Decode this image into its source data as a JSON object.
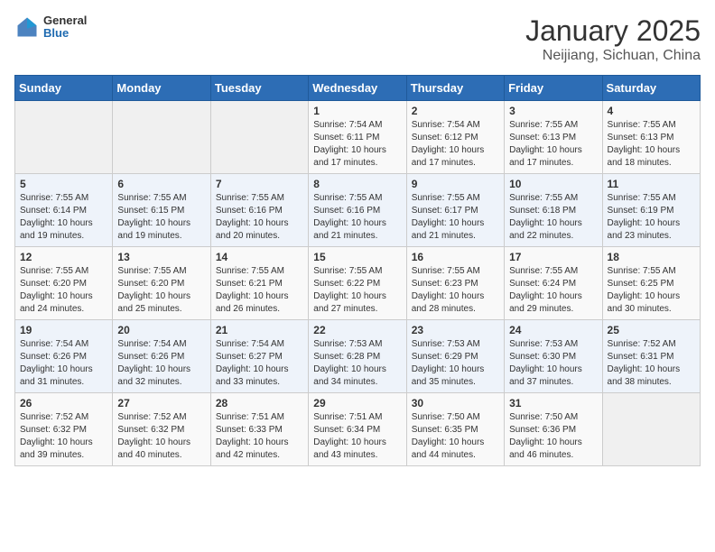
{
  "header": {
    "logo_general": "General",
    "logo_blue": "Blue",
    "title": "January 2025",
    "subtitle": "Neijiang, Sichuan, China"
  },
  "weekdays": [
    "Sunday",
    "Monday",
    "Tuesday",
    "Wednesday",
    "Thursday",
    "Friday",
    "Saturday"
  ],
  "weeks": [
    [
      {
        "day": "",
        "info": ""
      },
      {
        "day": "",
        "info": ""
      },
      {
        "day": "",
        "info": ""
      },
      {
        "day": "1",
        "info": "Sunrise: 7:54 AM\nSunset: 6:11 PM\nDaylight: 10 hours\nand 17 minutes."
      },
      {
        "day": "2",
        "info": "Sunrise: 7:54 AM\nSunset: 6:12 PM\nDaylight: 10 hours\nand 17 minutes."
      },
      {
        "day": "3",
        "info": "Sunrise: 7:55 AM\nSunset: 6:13 PM\nDaylight: 10 hours\nand 17 minutes."
      },
      {
        "day": "4",
        "info": "Sunrise: 7:55 AM\nSunset: 6:13 PM\nDaylight: 10 hours\nand 18 minutes."
      }
    ],
    [
      {
        "day": "5",
        "info": "Sunrise: 7:55 AM\nSunset: 6:14 PM\nDaylight: 10 hours\nand 19 minutes."
      },
      {
        "day": "6",
        "info": "Sunrise: 7:55 AM\nSunset: 6:15 PM\nDaylight: 10 hours\nand 19 minutes."
      },
      {
        "day": "7",
        "info": "Sunrise: 7:55 AM\nSunset: 6:16 PM\nDaylight: 10 hours\nand 20 minutes."
      },
      {
        "day": "8",
        "info": "Sunrise: 7:55 AM\nSunset: 6:16 PM\nDaylight: 10 hours\nand 21 minutes."
      },
      {
        "day": "9",
        "info": "Sunrise: 7:55 AM\nSunset: 6:17 PM\nDaylight: 10 hours\nand 21 minutes."
      },
      {
        "day": "10",
        "info": "Sunrise: 7:55 AM\nSunset: 6:18 PM\nDaylight: 10 hours\nand 22 minutes."
      },
      {
        "day": "11",
        "info": "Sunrise: 7:55 AM\nSunset: 6:19 PM\nDaylight: 10 hours\nand 23 minutes."
      }
    ],
    [
      {
        "day": "12",
        "info": "Sunrise: 7:55 AM\nSunset: 6:20 PM\nDaylight: 10 hours\nand 24 minutes."
      },
      {
        "day": "13",
        "info": "Sunrise: 7:55 AM\nSunset: 6:20 PM\nDaylight: 10 hours\nand 25 minutes."
      },
      {
        "day": "14",
        "info": "Sunrise: 7:55 AM\nSunset: 6:21 PM\nDaylight: 10 hours\nand 26 minutes."
      },
      {
        "day": "15",
        "info": "Sunrise: 7:55 AM\nSunset: 6:22 PM\nDaylight: 10 hours\nand 27 minutes."
      },
      {
        "day": "16",
        "info": "Sunrise: 7:55 AM\nSunset: 6:23 PM\nDaylight: 10 hours\nand 28 minutes."
      },
      {
        "day": "17",
        "info": "Sunrise: 7:55 AM\nSunset: 6:24 PM\nDaylight: 10 hours\nand 29 minutes."
      },
      {
        "day": "18",
        "info": "Sunrise: 7:55 AM\nSunset: 6:25 PM\nDaylight: 10 hours\nand 30 minutes."
      }
    ],
    [
      {
        "day": "19",
        "info": "Sunrise: 7:54 AM\nSunset: 6:26 PM\nDaylight: 10 hours\nand 31 minutes."
      },
      {
        "day": "20",
        "info": "Sunrise: 7:54 AM\nSunset: 6:26 PM\nDaylight: 10 hours\nand 32 minutes."
      },
      {
        "day": "21",
        "info": "Sunrise: 7:54 AM\nSunset: 6:27 PM\nDaylight: 10 hours\nand 33 minutes."
      },
      {
        "day": "22",
        "info": "Sunrise: 7:53 AM\nSunset: 6:28 PM\nDaylight: 10 hours\nand 34 minutes."
      },
      {
        "day": "23",
        "info": "Sunrise: 7:53 AM\nSunset: 6:29 PM\nDaylight: 10 hours\nand 35 minutes."
      },
      {
        "day": "24",
        "info": "Sunrise: 7:53 AM\nSunset: 6:30 PM\nDaylight: 10 hours\nand 37 minutes."
      },
      {
        "day": "25",
        "info": "Sunrise: 7:52 AM\nSunset: 6:31 PM\nDaylight: 10 hours\nand 38 minutes."
      }
    ],
    [
      {
        "day": "26",
        "info": "Sunrise: 7:52 AM\nSunset: 6:32 PM\nDaylight: 10 hours\nand 39 minutes."
      },
      {
        "day": "27",
        "info": "Sunrise: 7:52 AM\nSunset: 6:32 PM\nDaylight: 10 hours\nand 40 minutes."
      },
      {
        "day": "28",
        "info": "Sunrise: 7:51 AM\nSunset: 6:33 PM\nDaylight: 10 hours\nand 42 minutes."
      },
      {
        "day": "29",
        "info": "Sunrise: 7:51 AM\nSunset: 6:34 PM\nDaylight: 10 hours\nand 43 minutes."
      },
      {
        "day": "30",
        "info": "Sunrise: 7:50 AM\nSunset: 6:35 PM\nDaylight: 10 hours\nand 44 minutes."
      },
      {
        "day": "31",
        "info": "Sunrise: 7:50 AM\nSunset: 6:36 PM\nDaylight: 10 hours\nand 46 minutes."
      },
      {
        "day": "",
        "info": ""
      }
    ]
  ]
}
